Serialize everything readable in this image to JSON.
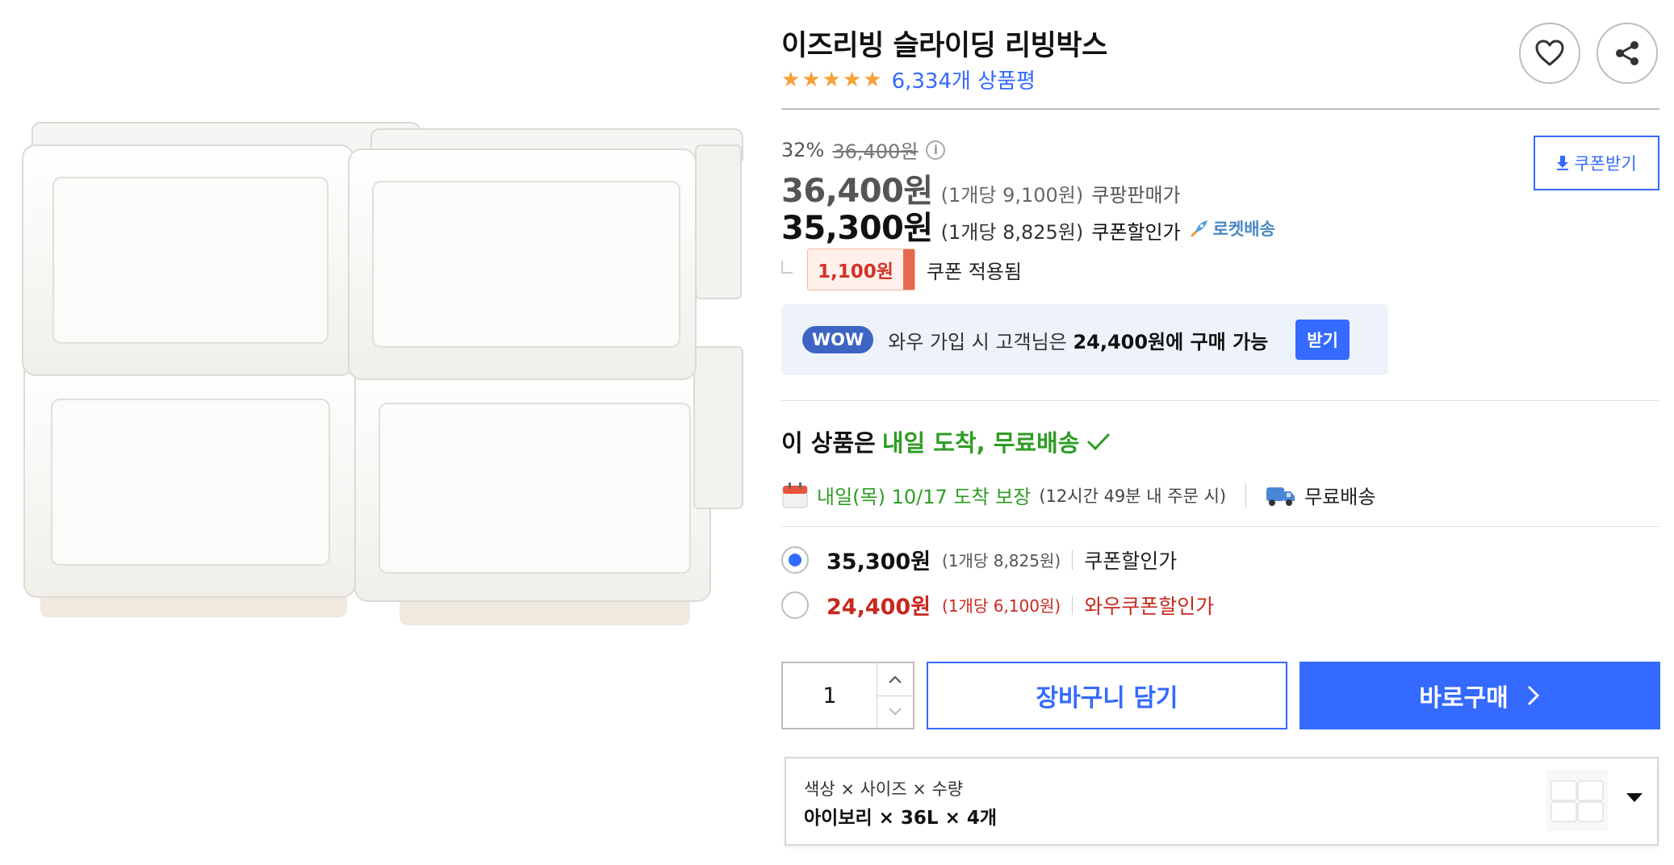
{
  "product": {
    "title": "이즈리빙 슬라이딩 리빙박스",
    "rating_stars": 5,
    "review_count": "6,334개 상품평"
  },
  "actions": {
    "wishlist_icon": "heart-icon",
    "share_icon": "share-icon"
  },
  "price": {
    "discount_rate": "32%",
    "original_price": "36,400원",
    "coupon_download_label": "쿠폰받기",
    "sale_price": "36,400원",
    "sale_unit": "(1개당 9,100원)",
    "sale_label": "쿠팡판매가",
    "coupon_price": "35,300원",
    "coupon_unit": "(1개당 8,825원)",
    "coupon_label": "쿠폰할인가",
    "rocket_label": "로켓배송",
    "coupon_amount": "1,100원",
    "coupon_applied": "쿠폰 적용됨"
  },
  "wow": {
    "badge": "WOW",
    "text_prefix": "와우 가입 시 고객님은 ",
    "text_bold": "24,400원에 구매 가능",
    "claim_label": "받기"
  },
  "delivery": {
    "headline_prefix": "이 상품은 ",
    "headline_highlight": "내일 도착, 무료배송",
    "date_text": "내일(목) 10/17 도착 보장",
    "condition": "(12시간 49분 내 주문 시)",
    "free_shipping": "무료배송"
  },
  "price_options": [
    {
      "price": "35,300원",
      "unit": "(1개당 8,825원)",
      "label": "쿠폰할인가",
      "selected": true
    },
    {
      "price": "24,400원",
      "unit": "(1개당 6,100원)",
      "label": "와우쿠폰할인가",
      "selected": false
    }
  ],
  "purchase": {
    "quantity": "1",
    "cart_label": "장바구니 담기",
    "buy_label": "바로구매"
  },
  "option_selector": {
    "label": "색상 × 사이즈 × 수량",
    "value": "아이보리 × 36L × 4개"
  },
  "colors": {
    "accent": "#346aff",
    "green": "#2e9d24",
    "red": "#c8281d",
    "star": "#f7a035"
  }
}
